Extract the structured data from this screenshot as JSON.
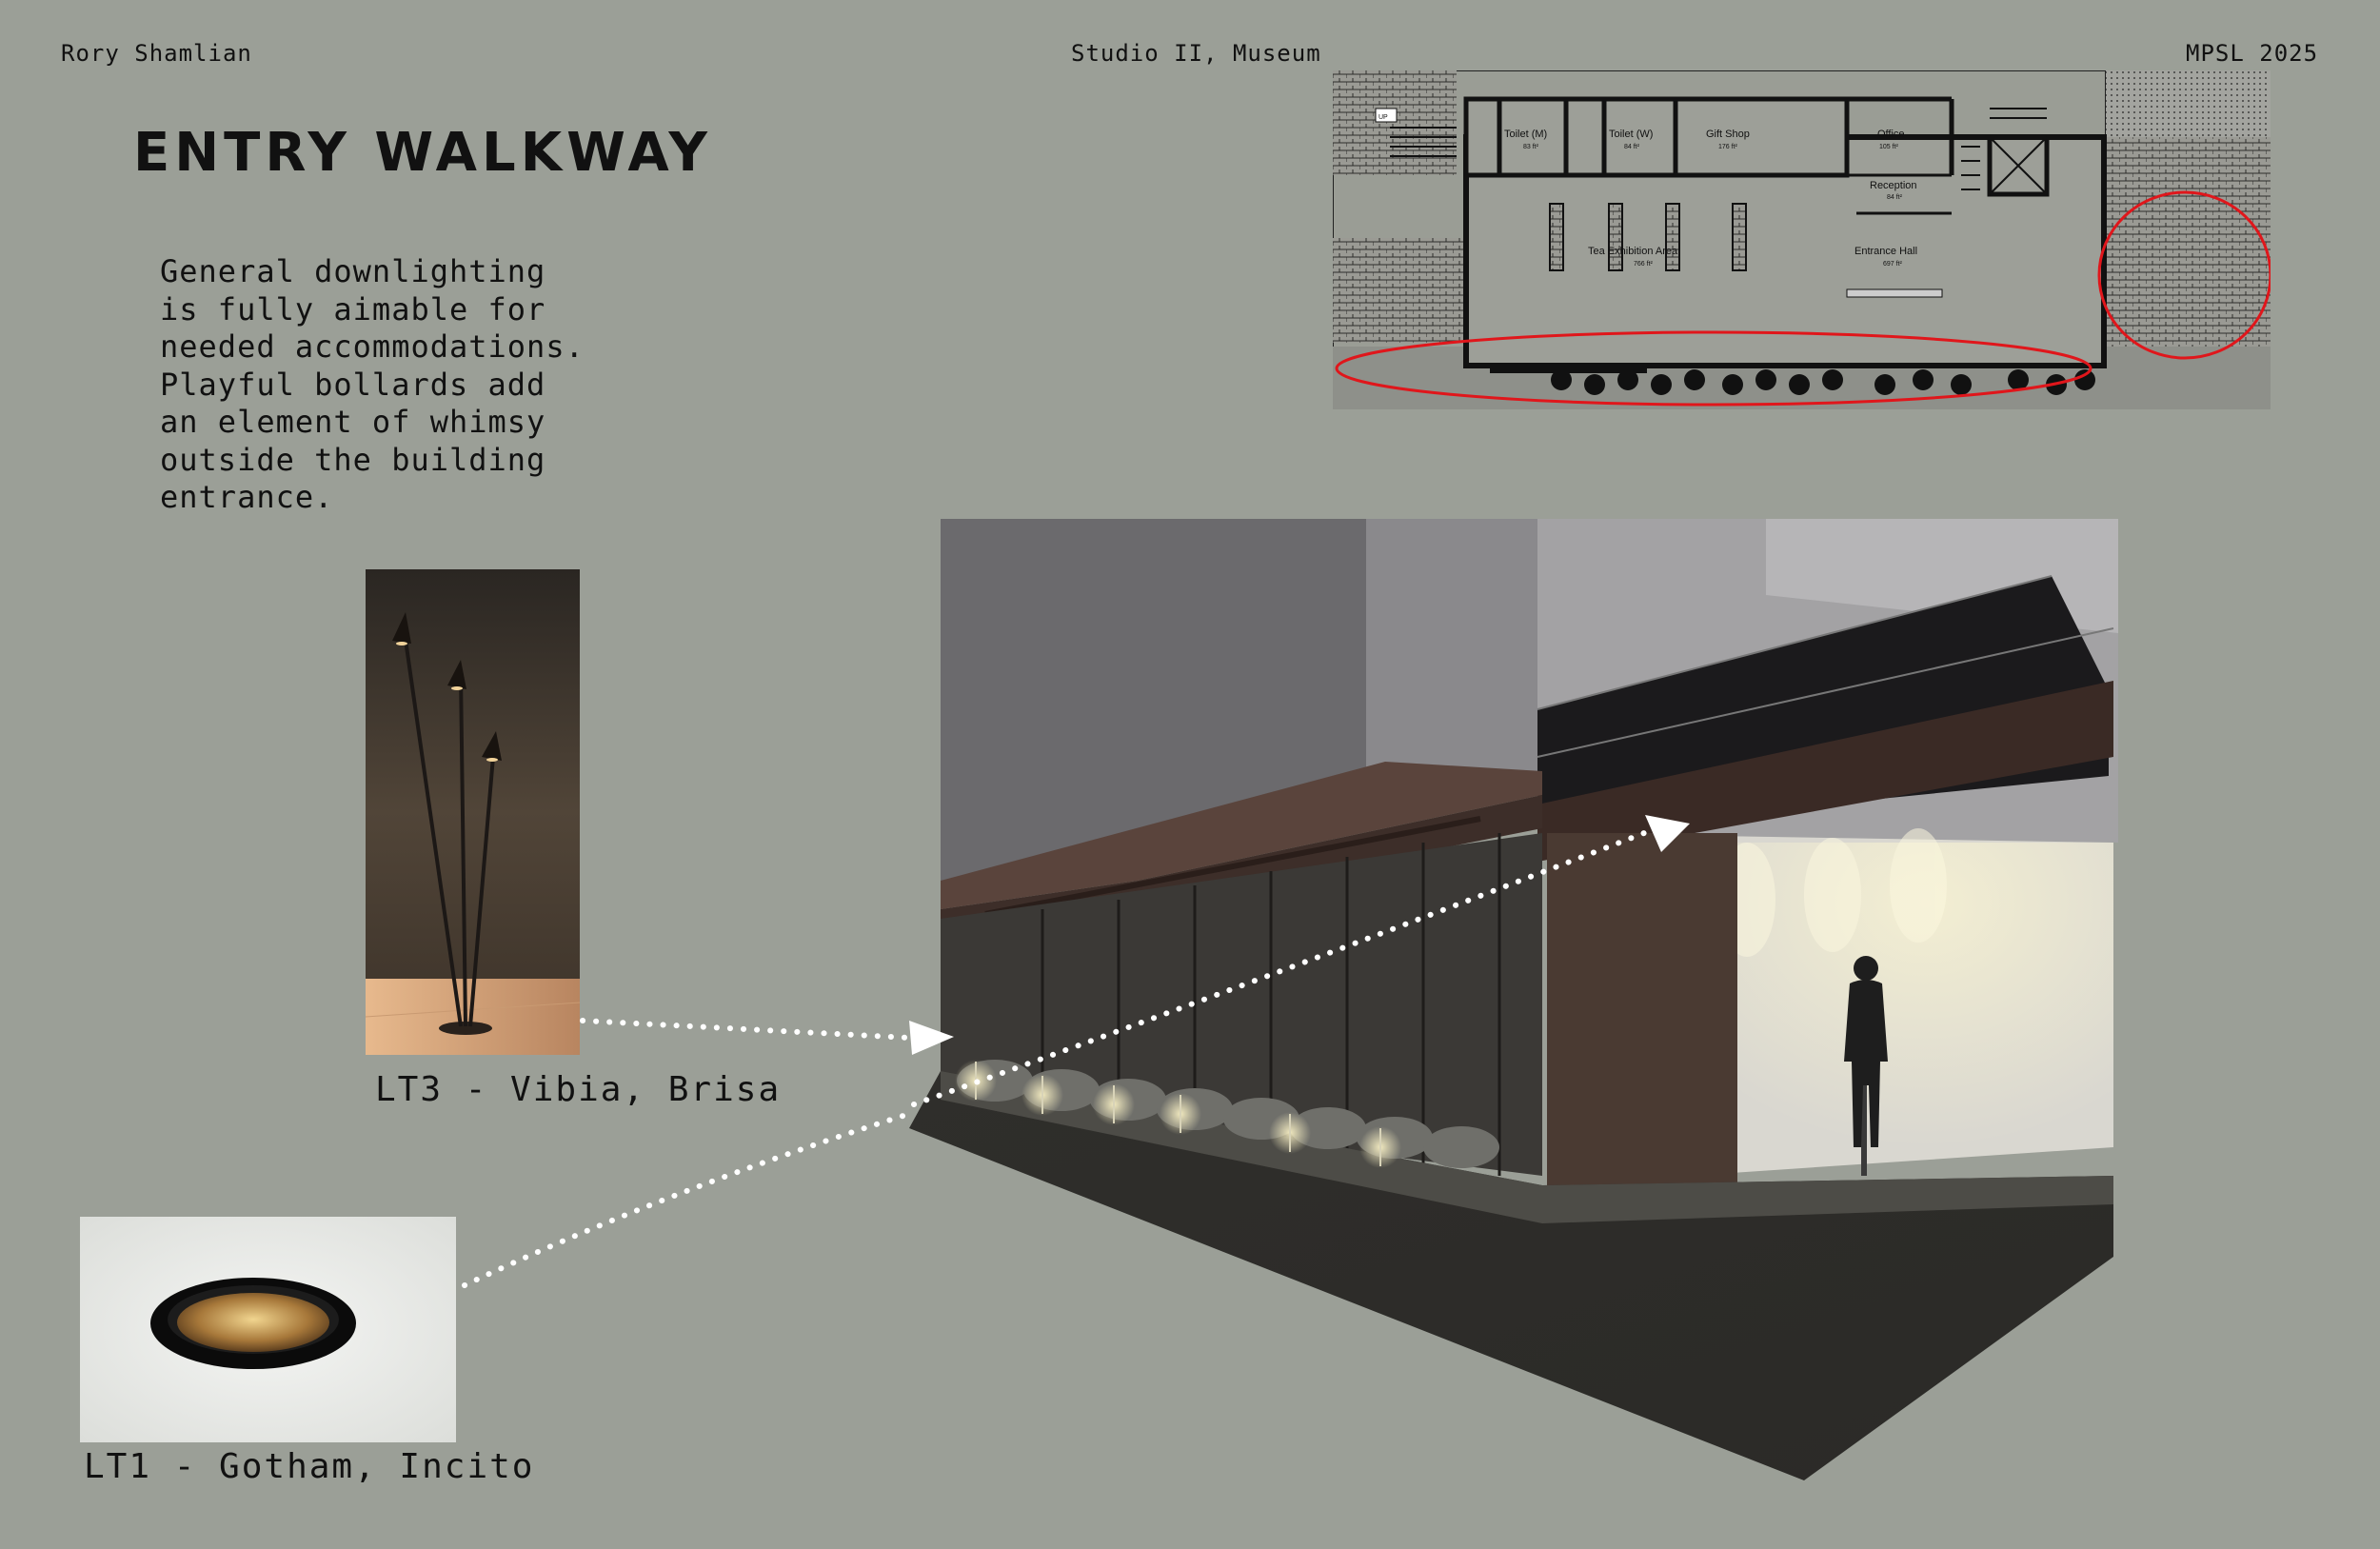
{
  "header": {
    "author": "Rory Shamlian",
    "course": "Studio II, Museum",
    "program": "MPSL 2025"
  },
  "page_title": "ENTRY WALKWAY",
  "description": "General downlighting\nis fully aimable for\nneeded accommodations.\nPlayful bollards add\nan element of whimsy\noutside the building\nentrance.",
  "fixtures": {
    "lt3": {
      "caption": "LT3 - Vibia, Brisa"
    },
    "lt1": {
      "caption": "LT1 - Gotham, Incito"
    }
  },
  "floor_plan": {
    "stair_tag": "UP",
    "rooms": [
      {
        "name": "Toilet (M)",
        "area": "83 ft²"
      },
      {
        "name": "Toilet (W)",
        "area": "84 ft²"
      },
      {
        "name": "Gift Shop",
        "area": "176 ft²"
      },
      {
        "name": "Office",
        "area": "105 ft²"
      },
      {
        "name": "Reception",
        "area": "84 ft²"
      },
      {
        "name": "Tea Exhibition Area",
        "area": "766 ft²"
      },
      {
        "name": "Entrance Hall",
        "area": "697 ft²"
      }
    ]
  },
  "colors": {
    "background": "#9b9f97",
    "highlight": "#e0161b",
    "arrow": "#ffffff"
  }
}
